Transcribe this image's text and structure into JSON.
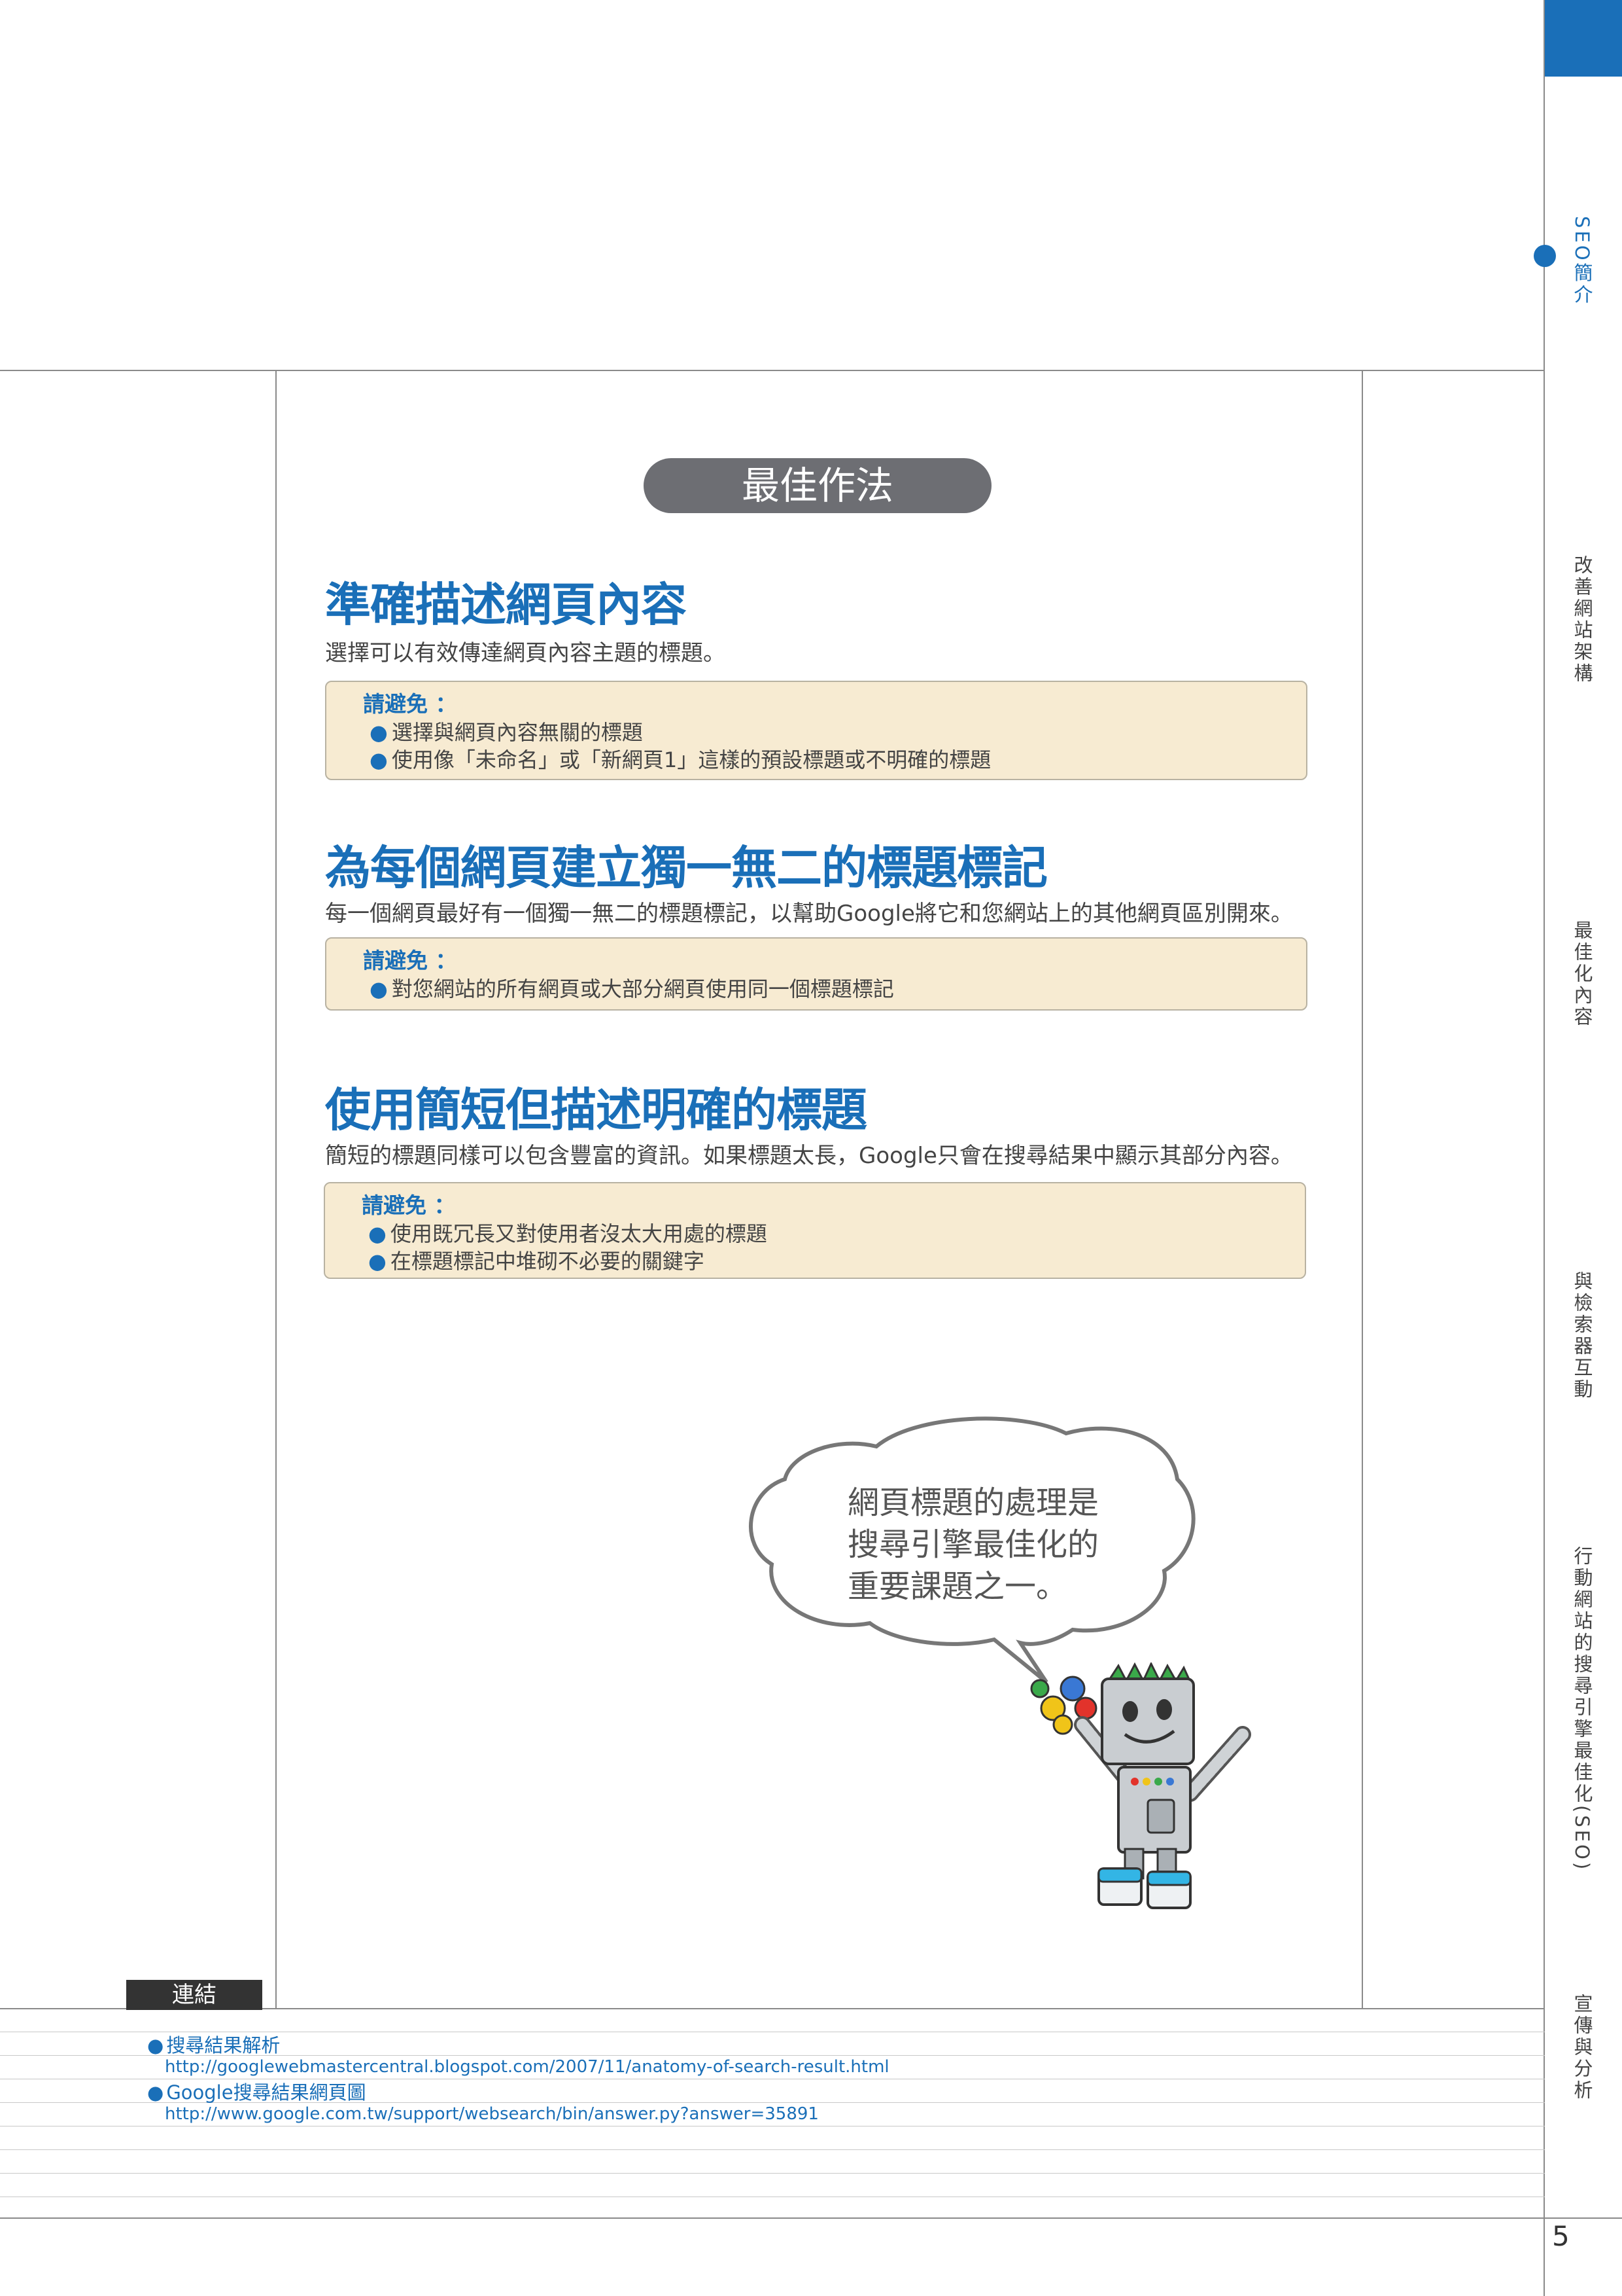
{
  "best_practice_label": "最佳作法",
  "sections": [
    {
      "title": "準確描述網頁內容",
      "description": "選擇可以有效傳達網頁內容主題的標題。",
      "avoid_label": "請避免 ：",
      "avoid_items": [
        "選擇與網頁內容無關的標題",
        "使用像「未命名」或「新網頁1」這樣的預設標題或不明確的標題"
      ]
    },
    {
      "title": "為每個網頁建立獨一無二的標題標記",
      "description": "每一個網頁最好有一個獨一無二的標題標記，以幫助Google將它和您網站上的其他網頁區別開來。",
      "avoid_label": "請避免 ：",
      "avoid_items": [
        "對您網站的所有網頁或大部分網頁使用同一個標題標記"
      ]
    },
    {
      "title": "使用簡短但描述明確的標題",
      "description": "簡短的標題同樣可以包含豐富的資訊。如果標題太長，Google只會在搜尋結果中顯示其部分內容。",
      "avoid_label": "請避免 ：",
      "avoid_items": [
        "使用既冗長又對使用者沒太大用處的標題",
        "在標題標記中堆砌不必要的關鍵字"
      ]
    }
  ],
  "speech_bubble": {
    "lines": [
      "網頁標題的處理是",
      "搜尋引擎最佳化的",
      "重要課題之一。"
    ]
  },
  "links": {
    "label": "連結",
    "items": [
      {
        "title": "搜尋結果解析",
        "url": "http://googlewebmastercentral.blogspot.com/2007/11/anatomy-of-search-result.html"
      },
      {
        "title": "Google搜尋結果網頁圖",
        "url": "http://www.google.com.tw/support/websearch/bin/answer.py?answer=35891"
      }
    ]
  },
  "side_tabs": [
    "SEO簡介",
    "改善網站架構",
    "最佳化內容",
    "與檢索器互動",
    "行動網站的搜尋引擎最佳化(SEO)",
    "宣傳與分析"
  ],
  "page_number": "5",
  "colors": {
    "accent": "#1a6fb8",
    "box_bg": "#f7ebd2",
    "pill": "#6d6e73"
  }
}
